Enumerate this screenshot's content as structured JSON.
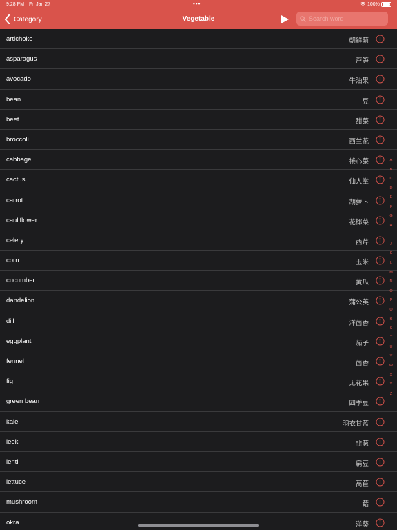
{
  "status_bar": {
    "time": "9:28 PM",
    "date": "Fri Jan 27",
    "battery": "100%"
  },
  "nav": {
    "back_label": "Category",
    "title": "Vegetable",
    "search_placeholder": "Search word"
  },
  "accent_color": "#d9534b",
  "items": [
    {
      "en": "artichoke",
      "zh": "朝鲜蓟"
    },
    {
      "en": "asparagus",
      "zh": "芦笋"
    },
    {
      "en": "avocado",
      "zh": "牛油果"
    },
    {
      "en": "bean",
      "zh": "豆"
    },
    {
      "en": "beet",
      "zh": "甜菜"
    },
    {
      "en": "broccoli",
      "zh": "西兰花"
    },
    {
      "en": "cabbage",
      "zh": "捲心菜"
    },
    {
      "en": "cactus",
      "zh": "仙人掌"
    },
    {
      "en": "carrot",
      "zh": "胡萝卜"
    },
    {
      "en": "cauliflower",
      "zh": "花椰菜"
    },
    {
      "en": "celery",
      "zh": "西芹"
    },
    {
      "en": "corn",
      "zh": "玉米"
    },
    {
      "en": "cucumber",
      "zh": "黄瓜"
    },
    {
      "en": "dandelion",
      "zh": "蒲公英"
    },
    {
      "en": "dill",
      "zh": "洋茴香"
    },
    {
      "en": "eggplant",
      "zh": "茄子"
    },
    {
      "en": "fennel",
      "zh": "茴香"
    },
    {
      "en": "fig",
      "zh": "无花果"
    },
    {
      "en": "green bean",
      "zh": "四季豆"
    },
    {
      "en": "kale",
      "zh": "羽衣甘蓝"
    },
    {
      "en": "leek",
      "zh": "韭葱"
    },
    {
      "en": "lentil",
      "zh": "扁豆"
    },
    {
      "en": "lettuce",
      "zh": "萵苣"
    },
    {
      "en": "mushroom",
      "zh": "菇"
    },
    {
      "en": "okra",
      "zh": "洋葵"
    }
  ],
  "index_letters": [
    "A",
    "B",
    "C",
    "D",
    "E",
    "F",
    "G",
    "H",
    "I",
    "J",
    "K",
    "L",
    "M",
    "N",
    "O",
    "P",
    "Q",
    "R",
    "S",
    "T",
    "U",
    "V",
    "W",
    "X",
    "Y",
    "Z"
  ]
}
